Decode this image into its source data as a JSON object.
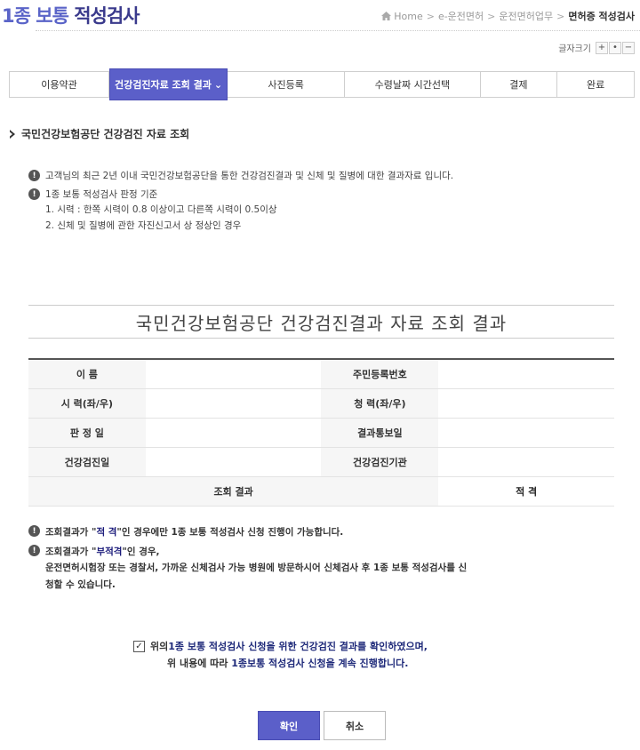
{
  "header": {
    "title_accent": "1종 보통",
    "title_rest": "적성검사",
    "breadcrumb": [
      "Home",
      "e-운전면허",
      "운전면허업무",
      "면허증 적성검사"
    ]
  },
  "font_size_control": {
    "label": "글자크기",
    "buttons": [
      "+",
      "•",
      "−"
    ]
  },
  "steps": [
    {
      "label": "이용약관",
      "active": false
    },
    {
      "label": "건강검진자료 조회 결과",
      "active": true
    },
    {
      "label": "사진등록",
      "active": false
    },
    {
      "label": "수령날짜 시간선택",
      "active": false
    },
    {
      "label": "결제",
      "active": false
    },
    {
      "label": "완료",
      "active": false
    }
  ],
  "active_chevron": "⌄",
  "section_heading": "국민건강보험공단 건강검진 자료 조회",
  "notices": {
    "n1": "고객님의 최근 2년 이내 국민건강보험공단을 통한 건강검진결과 및 신체 및 질병에 대한 결과자료 입니다.",
    "n2": "1종 보통 적성검사 판정 기준",
    "n2_sub1": "1. 시력 : 한쪽 시력이 0.8 이상이고 다른쪽 시력이 0.5이상",
    "n2_sub2": "2. 신체 및 질병에 관한 자진신고서 상 정상인 경우"
  },
  "result": {
    "title": "국민건강보험공단 건강검진결과 자료 조회 결과",
    "rows": [
      {
        "label1": "이 름",
        "value1": "",
        "label2": "주민등록번호",
        "value2": ""
      },
      {
        "label1": "시 력(좌/우)",
        "value1": "",
        "label2": "청 력(좌/우)",
        "value2": ""
      },
      {
        "label1": "판 정 일",
        "value1": "",
        "label2": "결과통보일",
        "value2": ""
      },
      {
        "label1": "건강검진일",
        "value1": "",
        "label2": "건강검진기관",
        "value2": ""
      }
    ],
    "summary_label": "조회 결과",
    "summary_value": "적 격"
  },
  "bottom_notices": {
    "b1_pre": "조회결과가 \"",
    "b1_q": "적 격",
    "b1_post": "\"인 경우에만 1종 보통 적성검사 신청 진행이 가능합니다.",
    "b2_pre": "조회결과가 \"",
    "b2_q": "부적격",
    "b2_post": "\"인 경우,",
    "b2_line2": "운전면허시험장 또는 경찰서, 가까운 신체검사 가능 병원에 방문하시어 신체검사 후 1종 보통 적성검사를 신",
    "b2_line3": "청할 수 있습니다."
  },
  "confirm": {
    "checked": true,
    "check_mark": "✓",
    "line1_pre": "위의 ",
    "line1_navy": "1종 보통 적성검사 신청을 위한 건강검진 결과를 확인하였으며,",
    "line2_pre": "위 내용에 따라 ",
    "line2_navy": "1종보통 적성검사 신청을 계속 진행합니다."
  },
  "buttons": {
    "ok": "확인",
    "cancel": "취소"
  },
  "colors": {
    "accent": "#5b5fc9",
    "navy": "#1f2a7a",
    "title": "#3b4a9e"
  }
}
